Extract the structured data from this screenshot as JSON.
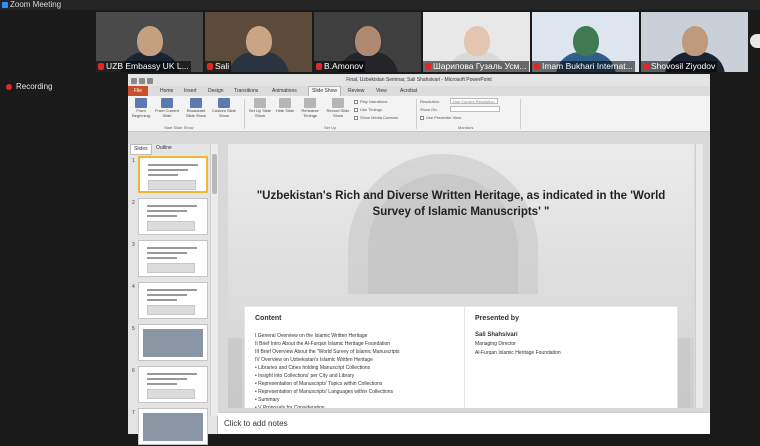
{
  "zoom": {
    "window_title": "Zoom Meeting",
    "recording_label": "Recording"
  },
  "participants": [
    {
      "name": "UZB Embassy UK L...",
      "bg": "#4a4a4a",
      "skin": "#c4a080",
      "suit": "#1b2433"
    },
    {
      "name": "Sali",
      "bg": "#5c4a3a",
      "skin": "#c9a586",
      "suit": "#2a3340"
    },
    {
      "name": "B.Amonov",
      "bg": "#3f3f3f",
      "skin": "#b08a70",
      "suit": "#23252b"
    },
    {
      "name": "Шарипова Гузаль Усм...",
      "bg": "#e8e8e8",
      "skin": "#e3c5b0",
      "suit": "#d9d9d9"
    },
    {
      "name": "Imam Bukhari Internat...",
      "bg": "#dde6ee",
      "skin": "#3f7a52",
      "suit": "#2f5f8a"
    },
    {
      "name": "Shovosil Ziyodov",
      "bg": "#c9d0d7",
      "skin": "#c09a7c",
      "suit": "#1c2230"
    }
  ],
  "powerpoint": {
    "window_title": "Final, Uzbekistan Seminar, Sali Shahsivari - Microsoft PowerPoint",
    "tabs": [
      "File",
      "Home",
      "Insert",
      "Design",
      "Transitions",
      "Animations",
      "Slide Show",
      "Review",
      "View",
      "Acrobat"
    ],
    "active_tab": "Slide Show",
    "ribbon": {
      "buttons": [
        "From Beginning",
        "From Current Slide",
        "Broadcast Slide Show",
        "Custom Slide Show",
        "Set Up Slide Show",
        "Hide Slide",
        "Rehearse Timings",
        "Record Slide Show"
      ],
      "group_start": "Start Slide Show",
      "group_setup": "Set Up",
      "group_monitors": "Monitors",
      "checkboxes": [
        "Play Narrations",
        "Use Timings",
        "Show Media Controls"
      ],
      "resolution_label": "Resolution:",
      "resolution_value": "Use Current Resolution",
      "show_on_label": "Show On:",
      "presenter_view": "Use Presenter View"
    },
    "panel_tabs": [
      "Slides",
      "Outline"
    ],
    "slide_numbers": [
      "1",
      "2",
      "3",
      "4",
      "5",
      "6",
      "7"
    ],
    "notes_placeholder": "Click to add notes"
  },
  "slide": {
    "title": "\"Uzbekistan's Rich and Diverse Written Heritage, as indicated in the 'World Survey of Islamic Manuscripts' \"",
    "content_heading": "Content",
    "content_items": [
      "I  General Overview on the Islamic Written Heritage",
      "II  Brief Intro About the Al-Furqan Islamic Heritage Foundation",
      "III  Brief Overview About the \"World Survey of Islamic Manuscripts",
      "IV  Overview on Uzbekistan's Islamic Written Heritage",
      "• Libraries and Cities holding Manuscript Collections",
      "• Insight into Collections' per City and Library",
      "• Representation of Manuscripts' Topics within Collections",
      "• Representation of Manuscripts' Languages within Collections",
      "• Summary",
      "• V  Proposals for Consideration",
      "• Links for further information and details"
    ],
    "presenter_heading": "Presented by",
    "presenter_name": "Sali Shahsivari",
    "presenter_role": "Managing Director",
    "presenter_org": "Al-Furqan Islamic Heritage Foundation"
  }
}
